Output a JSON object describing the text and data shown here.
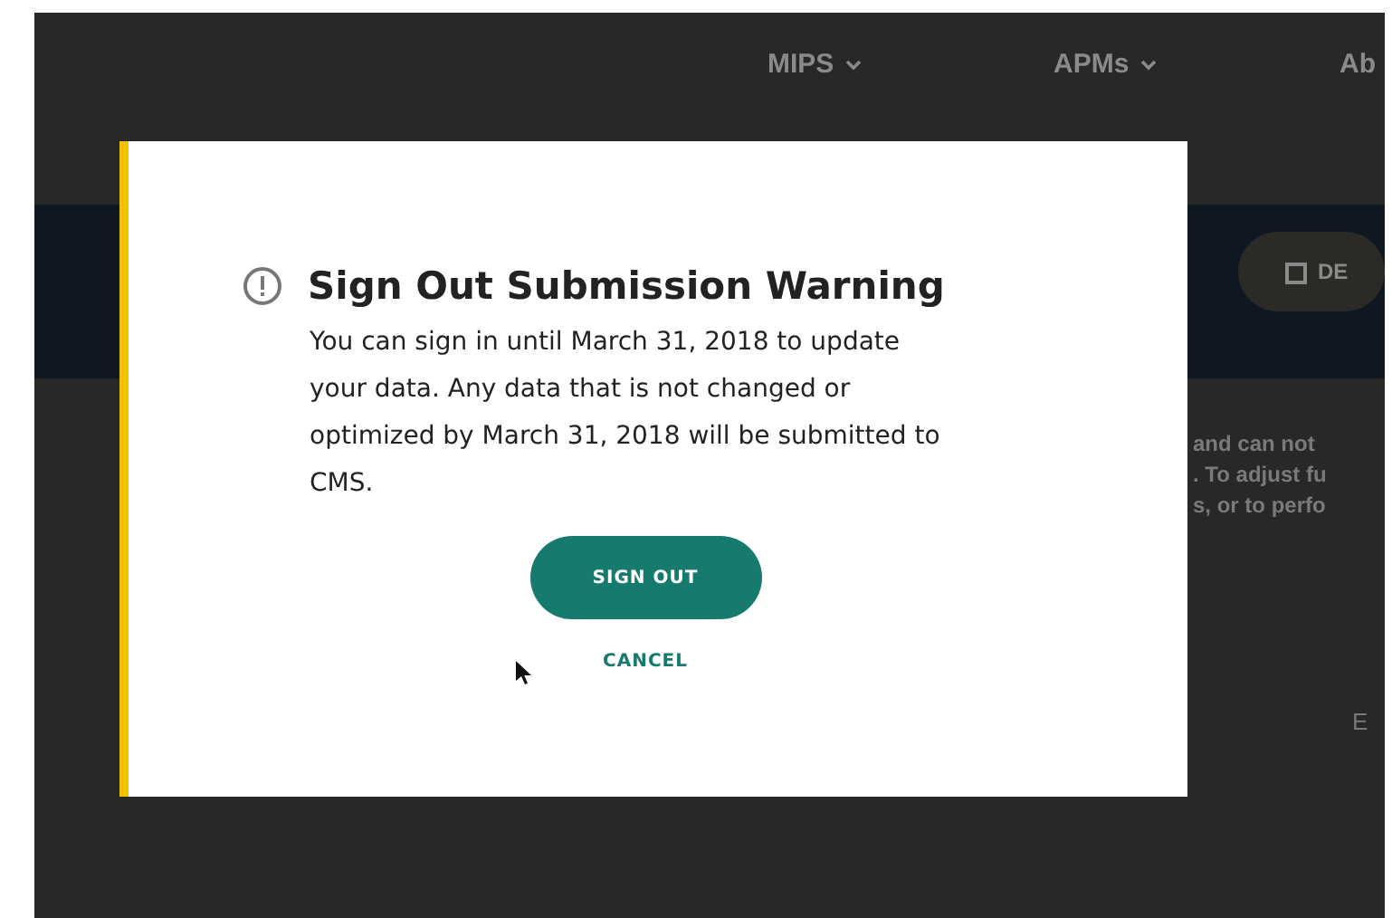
{
  "nav": [
    {
      "label": "MIPS",
      "has_menu": true
    },
    {
      "label": "APMs",
      "has_menu": true
    },
    {
      "label": "Ab"
    }
  ],
  "band": {
    "button": "DE"
  },
  "background_text": [
    "and can not",
    ". To adjust fu",
    "s, or to perfo"
  ],
  "background_footer": "E",
  "dialog": {
    "title": "Sign Out Submission Warning",
    "message": "You can sign in until March 31, 2018 to update your data. Any data that is not changed or optimized by March 31, 2018 will be submitted to CMS.",
    "primary_button": "SIGN OUT",
    "secondary_button": "CANCEL"
  }
}
